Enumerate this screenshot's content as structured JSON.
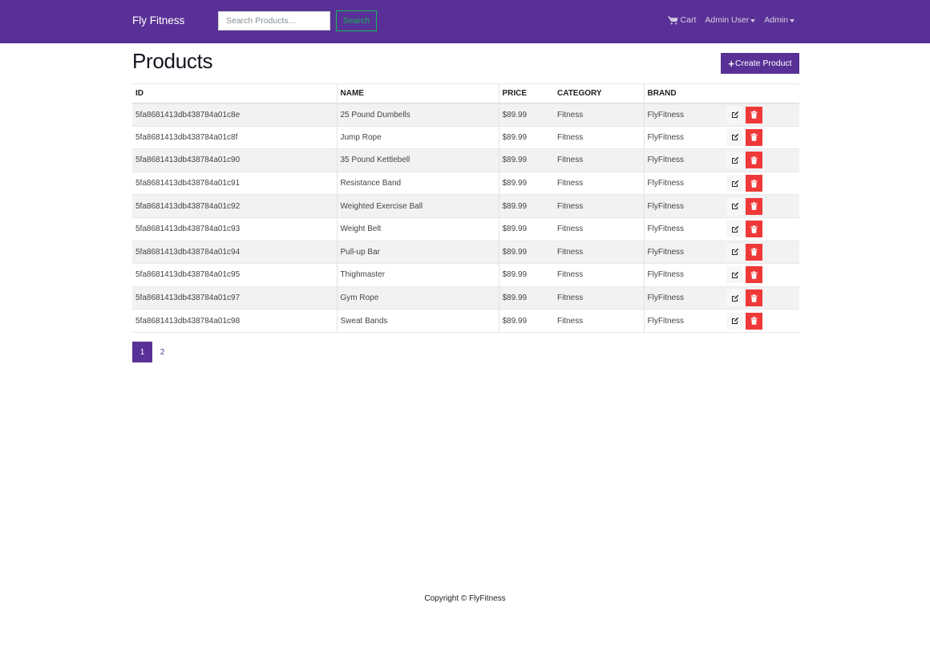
{
  "navbar": {
    "brand": "Fly Fitness",
    "search_placeholder": "Search Products...",
    "search_button": "Search",
    "cart_label": "Cart",
    "user_label": "Admin User",
    "admin_label": "Admin"
  },
  "page": {
    "title": "Products",
    "create_button": "Create Product"
  },
  "table": {
    "headers": {
      "id": "ID",
      "name": "NAME",
      "price": "PRICE",
      "category": "CATEGORY",
      "brand": "BRAND"
    },
    "rows": [
      {
        "id": "5fa8681413db438784a01c8e",
        "name": "25 Pound Dumbells",
        "price": "$89.99",
        "category": "Fitness",
        "brand": "FlyFitness"
      },
      {
        "id": "5fa8681413db438784a01c8f",
        "name": "Jump Rope",
        "price": "$89.99",
        "category": "Fitness",
        "brand": "FlyFitness"
      },
      {
        "id": "5fa8681413db438784a01c90",
        "name": "35 Pound Kettlebell",
        "price": "$89.99",
        "category": "Fitness",
        "brand": "FlyFitness"
      },
      {
        "id": "5fa8681413db438784a01c91",
        "name": "Resistance Band",
        "price": "$89.99",
        "category": "Fitness",
        "brand": "FlyFitness"
      },
      {
        "id": "5fa8681413db438784a01c92",
        "name": "Weighted Exercise Ball",
        "price": "$89.99",
        "category": "Fitness",
        "brand": "FlyFitness"
      },
      {
        "id": "5fa8681413db438784a01c93",
        "name": "Weight Belt",
        "price": "$89.99",
        "category": "Fitness",
        "brand": "FlyFitness"
      },
      {
        "id": "5fa8681413db438784a01c94",
        "name": "Pull-up Bar",
        "price": "$89.99",
        "category": "Fitness",
        "brand": "FlyFitness"
      },
      {
        "id": "5fa8681413db438784a01c95",
        "name": "Thighmaster",
        "price": "$89.99",
        "category": "Fitness",
        "brand": "FlyFitness"
      },
      {
        "id": "5fa8681413db438784a01c97",
        "name": "Gym Rope",
        "price": "$89.99",
        "category": "Fitness",
        "brand": "FlyFitness"
      },
      {
        "id": "5fa8681413db438784a01c98",
        "name": "Sweat Bands",
        "price": "$89.99",
        "category": "Fitness",
        "brand": "FlyFitness"
      }
    ]
  },
  "pagination": {
    "pages": [
      "1",
      "2"
    ],
    "active": "1"
  },
  "footer": {
    "copyright": "Copyright © FlyFitness"
  },
  "colors": {
    "primary": "#593196",
    "success": "#13b955",
    "danger": "#ef3939"
  },
  "icons": {
    "cart": "shopping-cart-icon",
    "edit": "edit-icon",
    "delete": "trash-icon",
    "create": "plus-icon"
  }
}
